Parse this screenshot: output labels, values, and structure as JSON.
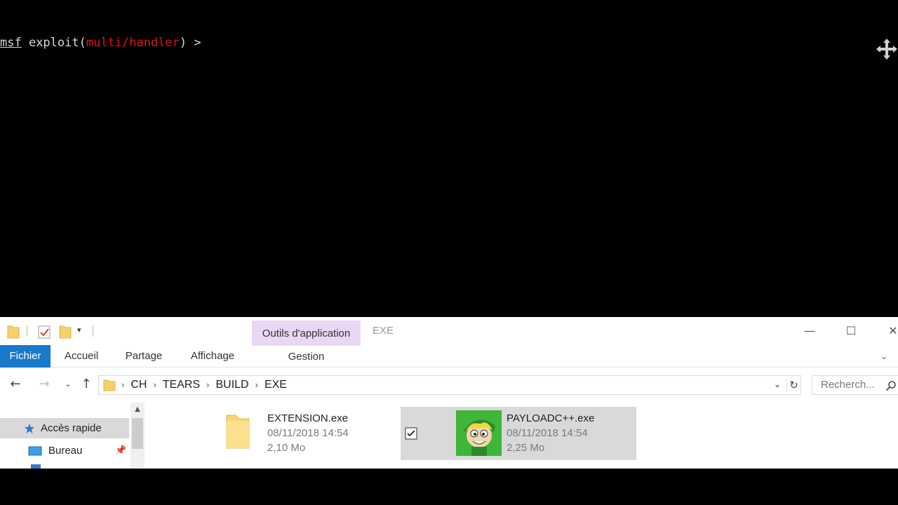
{
  "terminal": {
    "prompt_prefix": "msf",
    "prompt_command": " exploit(",
    "prompt_module": "multi/handler",
    "prompt_suffix": ") >",
    "module_color": "#e01414"
  },
  "explorer": {
    "window_title": "EXE",
    "contextual_tab_header": "Outils d'application",
    "ribbon_tabs": {
      "fichier": "Fichier",
      "accueil": "Accueil",
      "partage": "Partage",
      "affichage": "Affichage",
      "gestion": "Gestion"
    },
    "breadcrumb": [
      "CH",
      "TEARS",
      "BUILD",
      "EXE"
    ],
    "search_placeholder": "Recherch...",
    "nav_pane": {
      "quick_access": "Accès rapide",
      "bureau": "Bureau"
    },
    "files": [
      {
        "name": "EXTENSION.exe",
        "date": "08/11/2018 14:54",
        "size": "2,10 Mo",
        "icon": "folder-icon",
        "selected": false
      },
      {
        "name": "PAYLOADC++.exe",
        "date": "08/11/2018 14:54",
        "size": "2,25 Mo",
        "icon": "cartoon-face-icon",
        "selected": true
      }
    ],
    "accent_color": "#1979ca",
    "context_tab_color": "#e9d7f3"
  }
}
